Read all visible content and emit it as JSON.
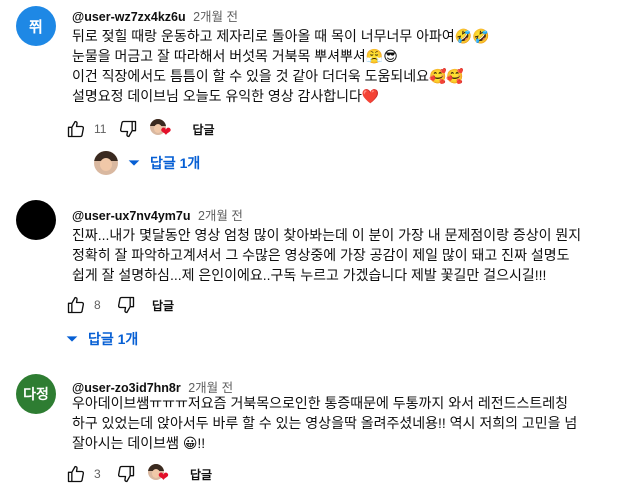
{
  "comments": [
    {
      "avatar_text": "쮜",
      "avatar_color": "#1e88e5",
      "author": "@user-wz7zx4kz6u",
      "time": "2개월 전",
      "lines": [
        "뒤로 젖힐 때랑 운동하고 제자리로 돌아올 때 목이 너무너무 아파여🤣🤣",
        "눈물을 머금고 잘 따라해서 버섯목 거북목 뿌셔뿌셔😤😎",
        "이건 직장에서도 틈틈이 할 수 있을 것 같아 더더욱 도움되네요🥰🥰",
        "설명요정 데이브님 오늘도 유익한 영상 감사합니다❤️"
      ],
      "likes": "11",
      "reply_label": "답글",
      "replies_label": "답글 1개"
    },
    {
      "avatar_text": "",
      "avatar_color": "#000000",
      "author": "@user-ux7nv4ym7u",
      "time": "2개월 전",
      "lines": [
        "진짜...내가 몇달동안 영상 엄청 많이 찾아봐는데 이 분이 가장 내 문제점이랑 증상이 뭔지",
        "정확히 잘 파악하고계셔서 그 수많은 영상중에 가장 공감이 제일 많이 돼고 진짜 설명도",
        "쉽게 잘 설명하심...제 은인이에요..구독 누르고 가겠습니다 제발 꽃길만 걸으시길!!!"
      ],
      "likes": "8",
      "reply_label": "답글",
      "replies_label": "답글 1개"
    },
    {
      "avatar_text": "다정",
      "avatar_color": "#2e7d32",
      "author": "@user-zo3id7hn8r",
      "time": "2개월 전",
      "lines": [
        "우아데이브쌤ㅠㅠㅠ저요즘 거북목으로인한 통증때문에 두통까지 와서 레전드스트레칭",
        "하구 있었는데 앉아서두 바루 할 수 있는 영상을딱 올려주셨네용!! 역시 저희의 고민을 넘",
        "잘아시는 데이브쌤 😀!!"
      ],
      "likes": "3",
      "reply_label": "답글"
    }
  ]
}
